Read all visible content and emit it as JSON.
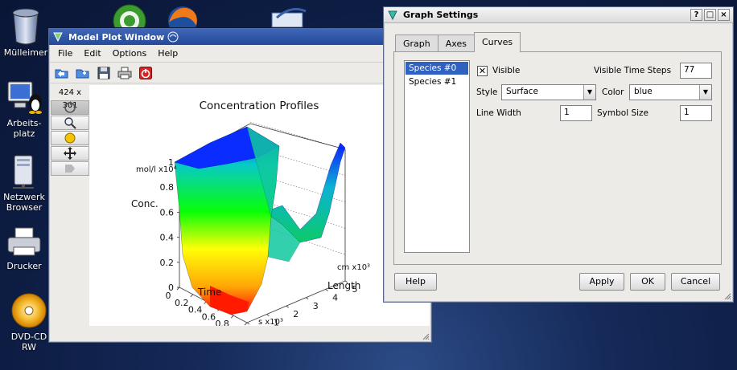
{
  "desktop": {
    "icons": [
      {
        "label": "Mülleimer"
      },
      {
        "label": "Arbeits-\nplatz"
      },
      {
        "label": "Netzwerk\nBrowser"
      },
      {
        "label": "Drucker"
      },
      {
        "label": "DVD-CD\nRW"
      }
    ]
  },
  "plot_window": {
    "title": "Model Plot Window",
    "menu": [
      "File",
      "Edit",
      "Options",
      "Help"
    ],
    "size_label": "424 x 301"
  },
  "chart_data": {
    "type": "surface",
    "title": "Concentration Profiles",
    "zlabel": "Conc.",
    "z_unit": "mol/l x10⁴",
    "z_ticks": [
      "0",
      "0.2",
      "0.4",
      "0.6",
      "0.8",
      "1"
    ],
    "xlabel": "Time",
    "x_unit": "s x10³",
    "x_ticks": [
      "0",
      "0.2",
      "0.4",
      "0.6",
      "0.8",
      "1"
    ],
    "ylabel": "Length",
    "y_unit": "cm x10³",
    "y_ticks": [
      "0",
      "1",
      "2",
      "3",
      "4",
      "5"
    ],
    "zlim": [
      0,
      1
    ],
    "colormap": [
      "#ff0000",
      "#ffa500",
      "#ffff00",
      "#00ff00",
      "#00c8c8",
      "#0000ff"
    ]
  },
  "dialog": {
    "title": "Graph Settings",
    "tabs": [
      "Graph",
      "Axes",
      "Curves"
    ],
    "active_tab": "Curves",
    "species": [
      "Species #0",
      "Species #1"
    ],
    "visible_label": "Visible",
    "visible_checked": true,
    "visible_time_steps_label": "Visible Time Steps",
    "visible_time_steps": "77",
    "style_label": "Style",
    "style_value": "Surface",
    "color_label": "Color",
    "color_value": "blue",
    "line_width_label": "Line Width",
    "line_width": "1",
    "symbol_size_label": "Symbol Size",
    "symbol_size": "1",
    "buttons": {
      "help": "Help",
      "apply": "Apply",
      "ok": "OK",
      "cancel": "Cancel"
    }
  }
}
